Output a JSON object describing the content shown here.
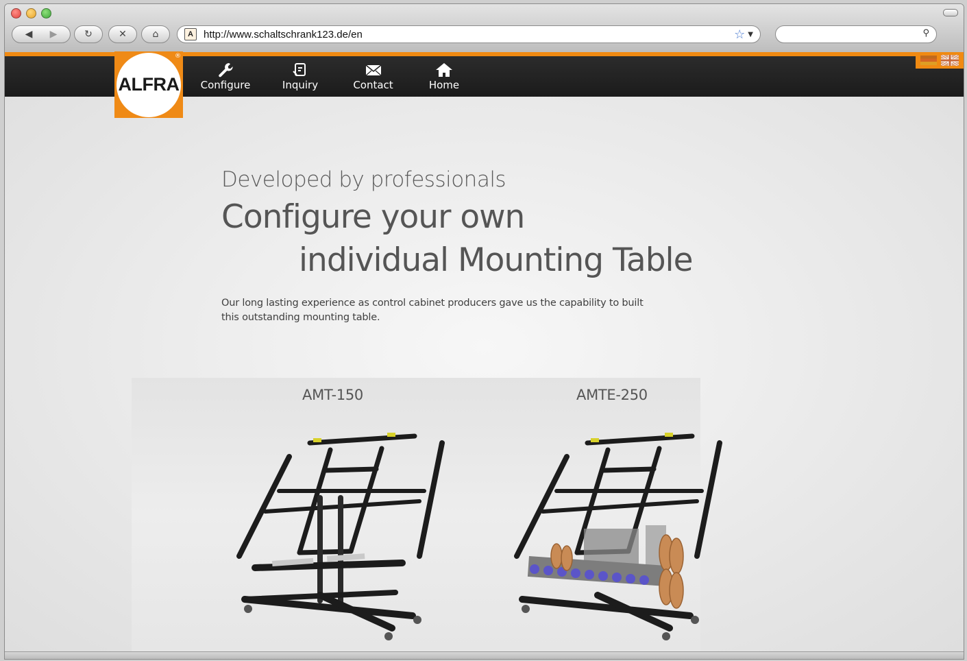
{
  "browser": {
    "nav_back": "◀",
    "nav_forward": "▶",
    "reload": "↻",
    "stop": "✕",
    "home": "⌂",
    "url": "http://www.schaltschrank123.de/en",
    "favicon_letter": "A",
    "bookmark_star": "☆",
    "url_dropdown": "▼",
    "search_icon": "⚲",
    "search_value": ""
  },
  "site": {
    "logo_text": "ALFRA",
    "logo_reg": "®",
    "nav": [
      {
        "label": "Configure",
        "icon": "wrench-icon"
      },
      {
        "label": "Inquiry",
        "icon": "inquiry-icon"
      },
      {
        "label": "Contact",
        "icon": "envelope-icon"
      },
      {
        "label": "Home",
        "icon": "house-icon"
      }
    ],
    "languages": [
      "de",
      "en"
    ]
  },
  "hero": {
    "kicker": "Developed by professionals",
    "title_line1": "Configure your own",
    "title_line2": "individual Mounting Table",
    "description": "Our long lasting experience as control cabinet producers gave us the capability to built this outstanding mounting table."
  },
  "products": [
    {
      "name": "AMT-150"
    },
    {
      "name": "AMTE-250"
    }
  ],
  "colors": {
    "accent": "#f08a12",
    "nav_bg": "#222222",
    "table_frame": "#1c1c1c"
  }
}
